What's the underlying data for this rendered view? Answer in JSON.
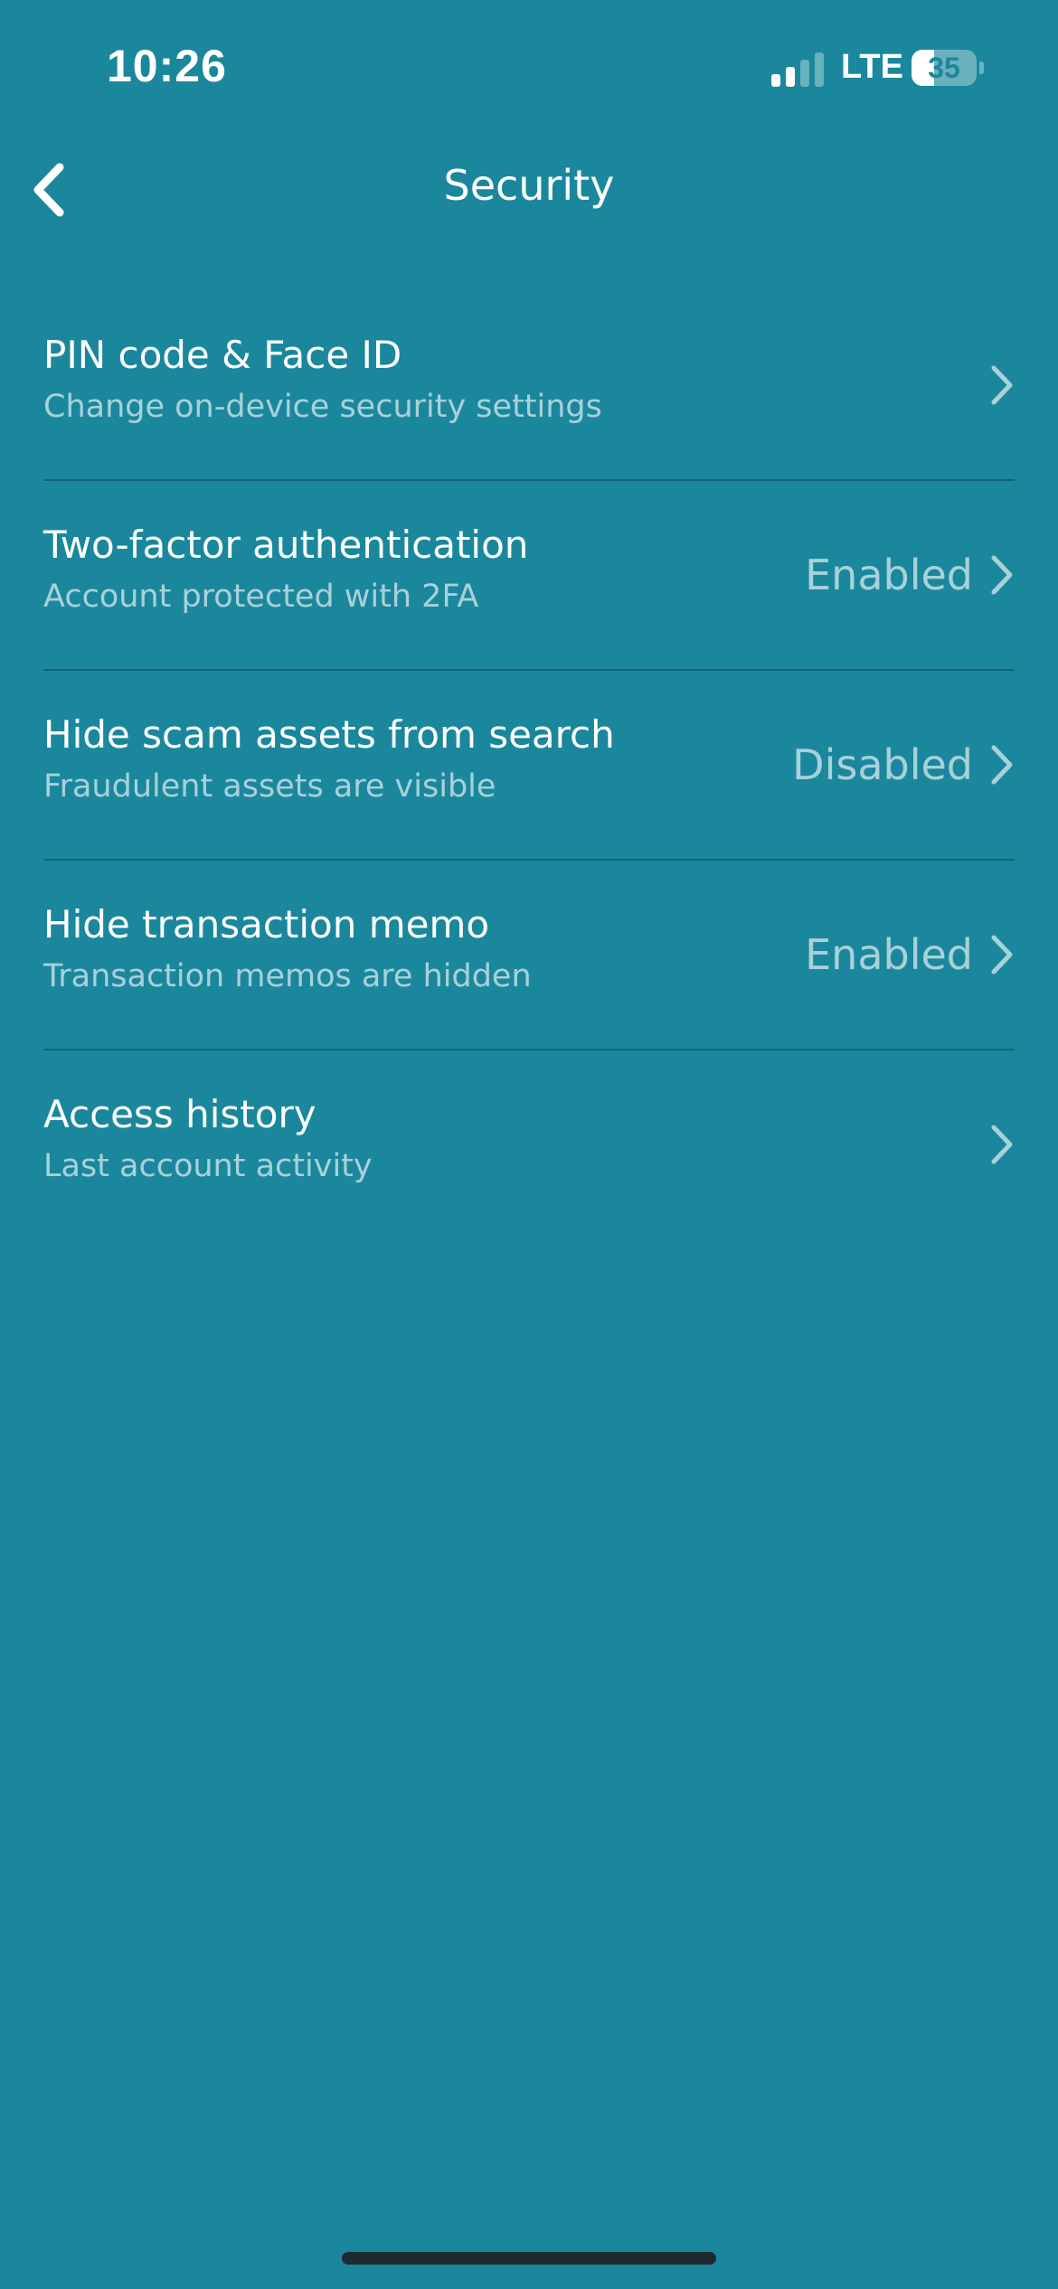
{
  "status_bar": {
    "time": "10:26",
    "network": "LTE",
    "battery_level": "35",
    "battery_fraction": 0.35,
    "signal_bars_active": 2,
    "signal_bars_total": 4
  },
  "nav": {
    "title": "Security",
    "back_icon": "chevron-left-icon"
  },
  "settings": [
    {
      "title": "PIN code & Face ID",
      "subtitle": "Change on-device security settings",
      "status": ""
    },
    {
      "title": "Two-factor authentication",
      "subtitle": "Account protected with 2FA",
      "status": "Enabled"
    },
    {
      "title": "Hide scam assets from search",
      "subtitle": "Fraudulent assets are visible",
      "status": "Disabled"
    },
    {
      "title": "Hide transaction memo",
      "subtitle": "Transaction memos are hidden",
      "status": "Enabled"
    },
    {
      "title": "Access history",
      "subtitle": "Last account activity",
      "status": ""
    }
  ],
  "colors": {
    "background": "#1b879c",
    "text_primary": "#ffffff",
    "divider": "#11687a",
    "home_indicator": "#1c2b30"
  }
}
